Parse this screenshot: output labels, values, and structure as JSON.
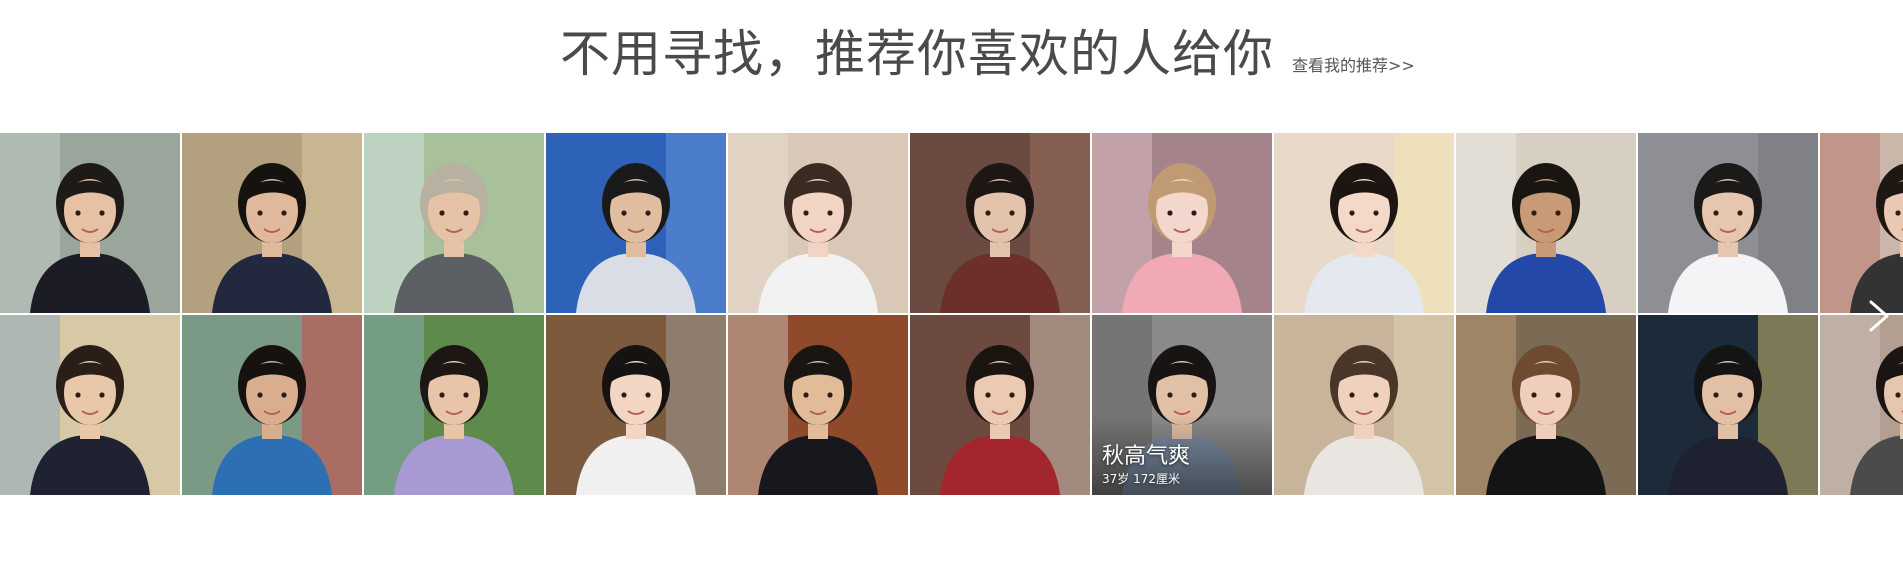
{
  "header": {
    "title": "不用寻找，推荐你喜欢的人给你",
    "more_link": "查看我的推荐>>"
  },
  "grid": {
    "rows": [
      [
        {
          "id": "r1c1",
          "bg": "#9aa59b",
          "skin": "#e6c1a4",
          "hair": "#1e1a17",
          "cloth": "#1c1d24",
          "accent": "#c9d6cf"
        },
        {
          "id": "r1c2",
          "bg": "#b3a07f",
          "skin": "#e0b89c",
          "hair": "#16120f",
          "cloth": "#22283e",
          "accent": "#e2d0a8"
        },
        {
          "id": "r1c3",
          "bg": "#a8c19a",
          "skin": "#e6c2a6",
          "hair": "#b8b0a0",
          "cloth": "#5c5f64",
          "accent": "#d6e6ef"
        },
        {
          "id": "r1c4",
          "bg": "#2e61b8",
          "skin": "#e0bd9f",
          "hair": "#1a1a1a",
          "cloth": "#d9dee6",
          "accent": "#6fa0e3"
        },
        {
          "id": "r1c5",
          "bg": "#d9c8b8",
          "skin": "#f1d4c4",
          "hair": "#3a2a22",
          "cloth": "#f2f2f2",
          "accent": "#e9dfd3"
        },
        {
          "id": "r1c6",
          "bg": "#6b4a42",
          "skin": "#e4c3ac",
          "hair": "#1d1613",
          "cloth": "#6d2f2a",
          "accent": "#a37a66"
        },
        {
          "id": "r1c7",
          "bg": "#a4848a",
          "skin": "#f3d6cc",
          "hair": "#c09a72",
          "cloth": "#f2a9b6",
          "accent": "#e8c6ce"
        },
        {
          "id": "r1c8",
          "bg": "#e8d9c9",
          "skin": "#f4d9c8",
          "hair": "#1c1512",
          "cloth": "#e4e8ef",
          "accent": "#f5e9a8"
        },
        {
          "id": "r1c9",
          "bg": "#d7cfc2",
          "skin": "#c99a76",
          "hair": "#191510",
          "cloth": "#2348a8",
          "accent": "#f0f0f0"
        },
        {
          "id": "r1c10",
          "bg": "#8d8f94",
          "skin": "#e6c6ae",
          "hair": "#1b1a18",
          "cloth": "#f4f4f6",
          "accent": "#6e7178"
        },
        {
          "id": "r1c11",
          "bg": "#cbb7aa",
          "skin": "#e9c8b4",
          "hair": "#1e1714",
          "cloth": "#333333",
          "accent": "#b86c66"
        }
      ],
      [
        {
          "id": "r2c1",
          "bg": "#d8c9a6",
          "skin": "#e9c8a9",
          "hair": "#2a1f18",
          "cloth": "#1f2230",
          "accent": "#7fa2c8"
        },
        {
          "id": "r2c2",
          "bg": "#7a9a86",
          "skin": "#d8ae8e",
          "hair": "#16120f",
          "cloth": "#2c6fb2",
          "accent": "#e23a3a"
        },
        {
          "id": "r2c3",
          "bg": "#5e8a4c",
          "skin": "#e8c5a9",
          "hair": "#1c1714",
          "cloth": "#a79ad3",
          "accent": "#8fb6c9"
        },
        {
          "id": "r2c4",
          "bg": "#7b5a3e",
          "skin": "#f2d5c2",
          "hair": "#151211",
          "cloth": "#f0f0f0",
          "accent": "#a7a7a7"
        },
        {
          "id": "r2c5",
          "bg": "#8e4a2a",
          "skin": "#e2bb98",
          "hair": "#181512",
          "cloth": "#16181d",
          "accent": "#d7d0c7"
        },
        {
          "id": "r2c6",
          "bg": "#6c4a3f",
          "skin": "#ecc9b2",
          "hair": "#1c1411",
          "cloth": "#a3262c",
          "accent": "#e4dccd"
        },
        {
          "id": "r2c7",
          "bg": "#8a8a8a",
          "skin": "#e2c0a5",
          "hair": "#171413",
          "cloth": "#7a8ba0",
          "accent": "#5a5a5a"
        },
        {
          "id": "r2c8",
          "bg": "#c7b49a",
          "skin": "#f0d1bd",
          "hair": "#4a3628",
          "cloth": "#e9e6e2",
          "accent": "#e5d6b8"
        },
        {
          "id": "r2c9",
          "bg": "#7b6b55",
          "skin": "#efcfbc",
          "hair": "#6e4a30",
          "cloth": "#141414",
          "accent": "#c8a77a"
        },
        {
          "id": "r2c10",
          "bg": "#1d2a3a",
          "skin": "#e2c0a6",
          "hair": "#141414",
          "cloth": "#1e2230",
          "accent": "#f3d77a"
        },
        {
          "id": "r2c11",
          "bg": "#b39f92",
          "skin": "#e7c6ae",
          "hair": "#1a1412",
          "cloth": "#4b4b4b",
          "accent": "#cfc4ba"
        }
      ]
    ],
    "featured": {
      "nickname": "秋高气爽",
      "meta": "37岁  172厘米"
    }
  },
  "nav": {
    "next_icon": "chevron-right-icon"
  }
}
